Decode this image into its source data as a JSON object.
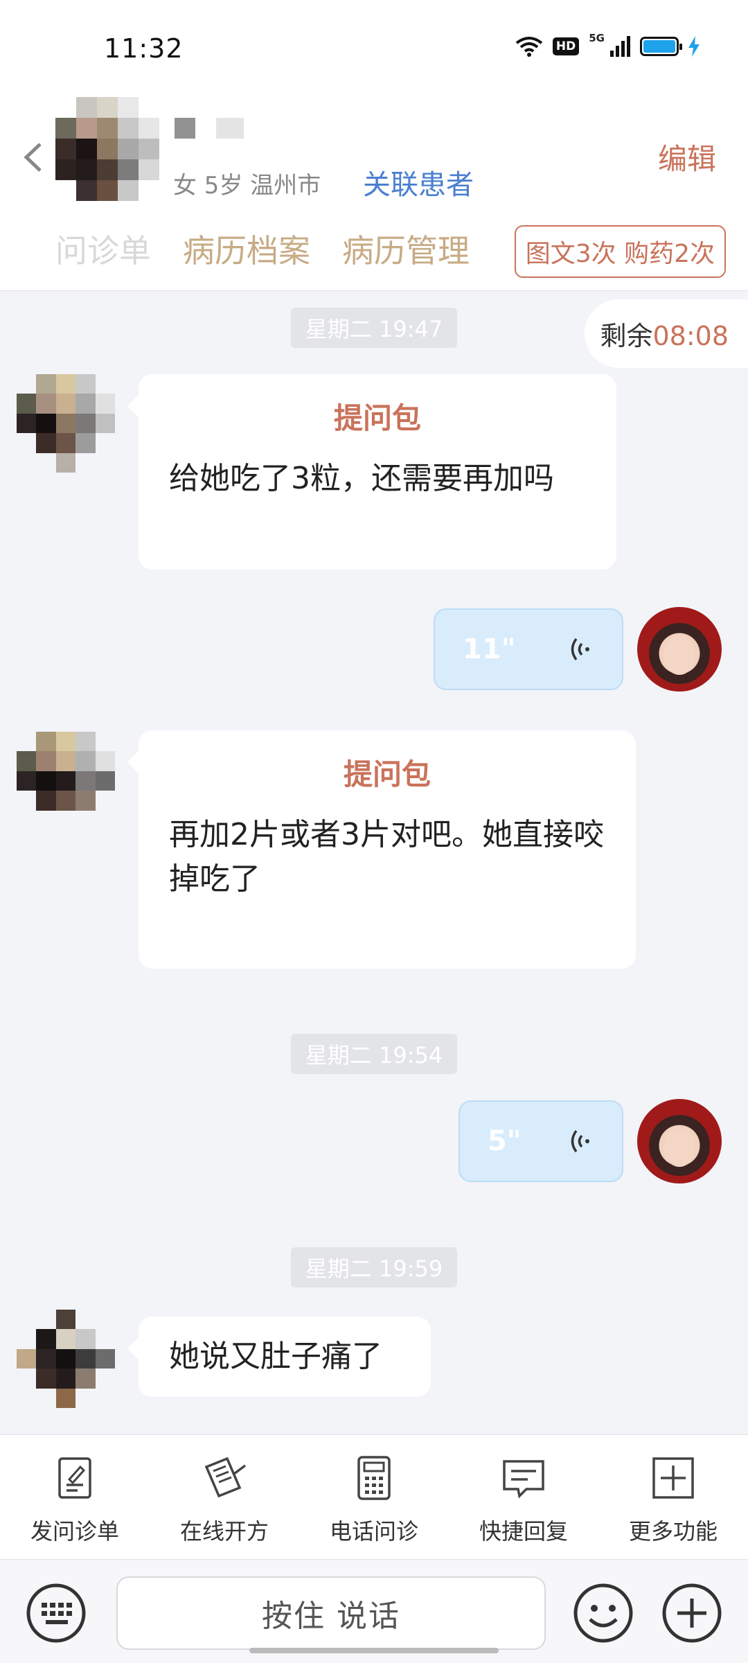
{
  "status_bar": {
    "time": "11:32",
    "hd": "HD",
    "network": "5G",
    "battery_level": 1.0,
    "battery_color": "#1ea2ea"
  },
  "header": {
    "patient_info": "女 5岁 温州市",
    "link_label": "关联患者",
    "edit_label": "编辑",
    "tabs": [
      "问诊单",
      "病历档案",
      "病历管理"
    ],
    "quota": "图文3次 购药2次"
  },
  "chat": {
    "remaining_label": "剩余",
    "remaining_time": "08:08",
    "timestamps": [
      "星期二 19:47",
      "星期二 19:54",
      "星期二 19:59"
    ],
    "messages": [
      {
        "from": "patient",
        "title": "提问包",
        "text": "给她吃了3粒，还需要再加吗"
      },
      {
        "from": "doctor",
        "type": "voice",
        "duration": "11\""
      },
      {
        "from": "patient",
        "title": "提问包",
        "text": "再加2片或者3片对吧。她直接咬掉吃了"
      },
      {
        "from": "doctor",
        "type": "voice",
        "duration": "5\""
      },
      {
        "from": "patient",
        "text": "她说又肚子痛了"
      }
    ]
  },
  "toolbar": {
    "items": [
      "发问诊单",
      "在线开方",
      "电话问诊",
      "快捷回复",
      "更多功能"
    ]
  },
  "input": {
    "hold_to_talk": "按住 说话"
  },
  "colors": {
    "accent": "#c9735b",
    "tab_gold": "#c7ab85",
    "link_blue": "#4a7fd0",
    "voice_bubble": "#d9ecfc"
  }
}
